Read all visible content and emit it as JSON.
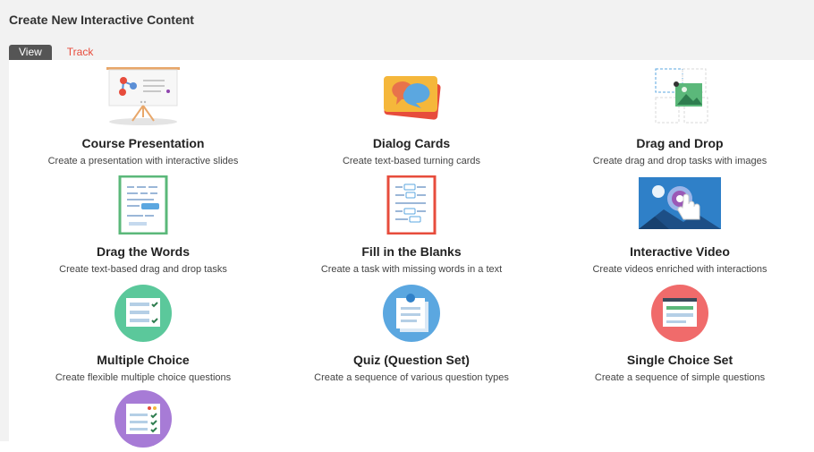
{
  "header": {
    "title": "Create New Interactive Content"
  },
  "tabs": [
    {
      "label": "View",
      "active": true
    },
    {
      "label": "Track",
      "active": false
    }
  ],
  "accent_color": "#e74c3c",
  "content_types": [
    {
      "name": "Course Presentation",
      "description": "Create a presentation with interactive slides",
      "icon": "presentation-board-icon"
    },
    {
      "name": "Dialog Cards",
      "description": "Create text-based turning cards",
      "icon": "speech-bubbles-cards-icon"
    },
    {
      "name": "Drag and Drop",
      "description": "Create drag and drop tasks with images",
      "icon": "drag-drop-image-icon"
    },
    {
      "name": "Drag the Words",
      "description": "Create text-based drag and drop tasks",
      "icon": "drag-words-document-icon"
    },
    {
      "name": "Fill in the Blanks",
      "description": "Create a task with missing words in a text",
      "icon": "fill-blanks-document-icon"
    },
    {
      "name": "Interactive Video",
      "description": "Create videos enriched with interactions",
      "icon": "interactive-video-icon"
    },
    {
      "name": "Multiple Choice",
      "description": "Create flexible multiple choice questions",
      "icon": "multiple-choice-icon"
    },
    {
      "name": "Quiz (Question Set)",
      "description": "Create a sequence of various question types",
      "icon": "quiz-question-set-icon"
    },
    {
      "name": "Single Choice Set",
      "description": "Create a sequence of simple questions",
      "icon": "single-choice-set-icon"
    },
    {
      "name": "",
      "description": "",
      "icon": "checklist-summary-icon"
    }
  ]
}
